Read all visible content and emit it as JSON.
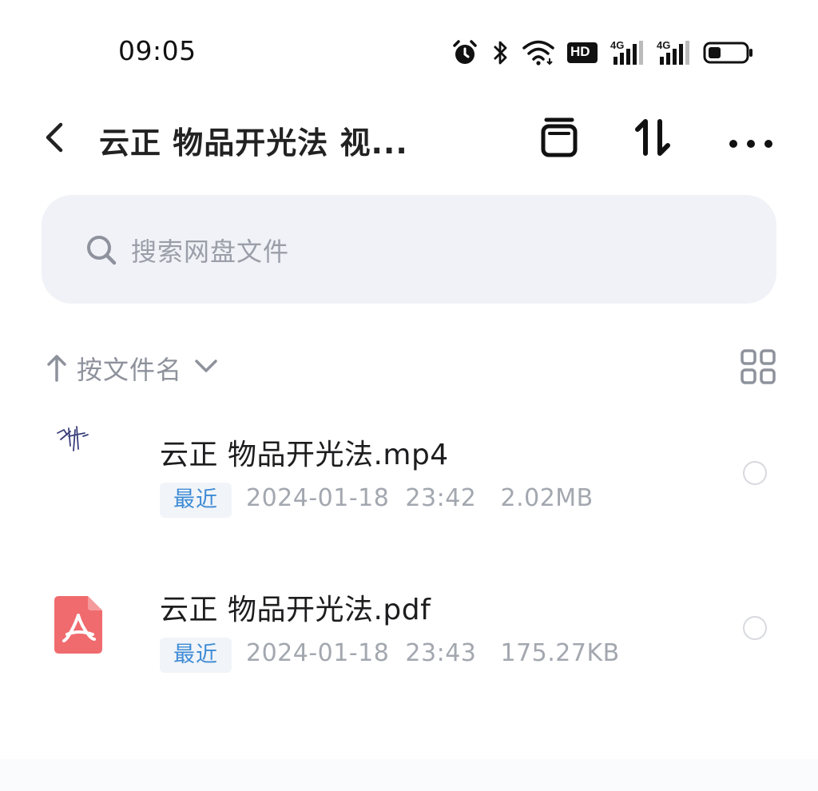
{
  "status_bar": {
    "time": "09:05",
    "icons": [
      "alarm-icon",
      "bluetooth-icon",
      "wifi-icon",
      "hd-icon",
      "signal-4g-icon",
      "signal-4g-icon",
      "battery-icon"
    ],
    "hd_label": "HD",
    "net_label_1": "4G",
    "net_label_2": "4G",
    "battery_level": 0.35
  },
  "header": {
    "title": "云正 物品开光法 视...",
    "actions": [
      "archive-icon",
      "sort-swap-icon",
      "more-icon"
    ]
  },
  "search": {
    "placeholder": "搜索网盘文件"
  },
  "sort": {
    "label": "按文件名"
  },
  "files": [
    {
      "name": "云正 物品开光法.mp4",
      "badge": "最近",
      "meta": "2024-01-18  23:42   2.02MB",
      "icon": "video-thumbnail"
    },
    {
      "name": "云正 物品开光法.pdf",
      "badge": "最近",
      "meta": "2024-01-18  23:43   175.27KB",
      "icon": "pdf-file-icon"
    }
  ],
  "colors": {
    "accent": "#3d8bd6",
    "search_bg": "#f1f2f7",
    "pdf_red": "#f06b6e"
  }
}
